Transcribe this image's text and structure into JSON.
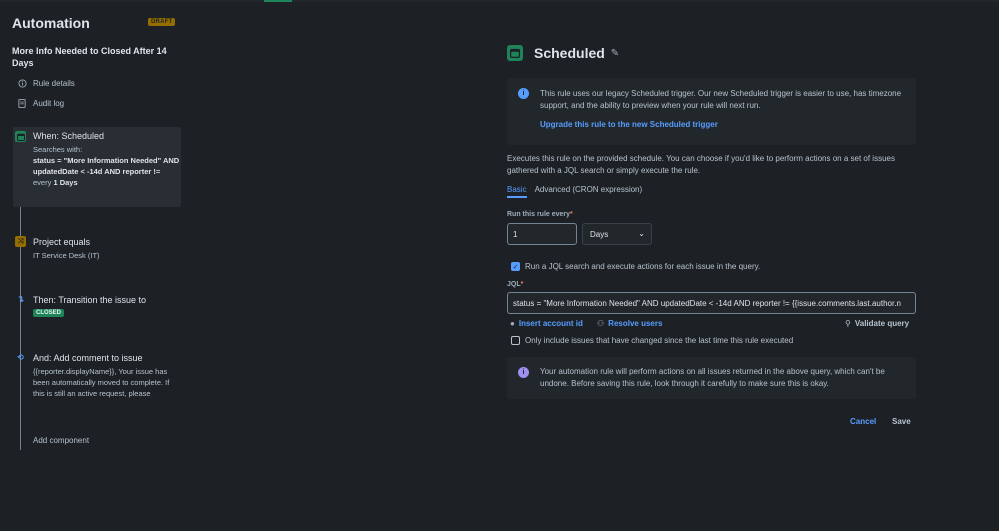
{
  "app": {
    "title": "Automation",
    "draft_badge": "DRAFT"
  },
  "rule": {
    "name": "More Info Needed to Closed After 14 Days"
  },
  "nav": {
    "rule_details": {
      "label": "Rule details",
      "icon": "info-icon"
    },
    "audit_log": {
      "label": "Audit log",
      "icon": "document-icon"
    }
  },
  "steps": [
    {
      "title": "When: Scheduled",
      "icon": "calendar-icon",
      "color": "#1f845a",
      "body_prefix": "Searches with:",
      "body_query": "status = \"More Information Needed\" AND updatedDate < -14d AND reporter !=",
      "body_every_prefix": "every",
      "body_every_value": "1 Days"
    },
    {
      "title": "Project equals",
      "icon": "branch-icon",
      "color": "#946f00",
      "body": "IT Service Desk (IT)"
    },
    {
      "title": "Then: Transition the issue to",
      "icon": "transition-icon",
      "color": "#579dff",
      "badge": "CLOSED"
    },
    {
      "title": "And: Add comment to issue",
      "icon": "comment-icon",
      "color": "#579dff",
      "body": "{{reporter.displayName}}, Your issue has been automatically moved to complete. If this is still an active request, please"
    }
  ],
  "add_component": "Add component",
  "panel": {
    "title": "Scheduled",
    "icon": "calendar-icon",
    "edit_icon": "pencil-icon",
    "info": {
      "icon": "info-icon",
      "text": "This rule uses our legacy Scheduled trigger. Our new Scheduled trigger is easier to use, has timezone support, and the ability to preview when your rule will next run.",
      "link": "Upgrade this rule to the new Scheduled trigger"
    },
    "description": "Executes this rule on the provided schedule. You can choose if you'd like to perform actions on a set of issues gathered with a JQL search or simply execute the rule.",
    "tabs": [
      {
        "label": "Basic",
        "active": true
      },
      {
        "label": "Advanced (CRON expression)",
        "active": false
      }
    ],
    "run_every": {
      "label": "Run this rule every",
      "required_mark": "*",
      "value": "1",
      "unit": "Days"
    },
    "jql_checkbox": {
      "label": "Run a JQL search and execute actions for each issue in the query.",
      "checked": true
    },
    "jql": {
      "label": "JQL",
      "required_mark": "*",
      "value": "status = \"More Information Needed\" AND updatedDate < -14d AND reporter != {{issue.comments.last.author.n"
    },
    "insert_account_id": "Insert account id",
    "resolve_users": "Resolve users",
    "validate_query": "Validate query",
    "only_changed": {
      "label": "Only include issues that have changed since the last time this rule executed",
      "checked": false
    },
    "warning": {
      "icon": "info-icon",
      "text": "Your automation rule will perform actions on all issues returned in the above query, which can't be undone. Before saving this rule, look through it carefully to make sure this is okay."
    },
    "cancel": "Cancel",
    "save": "Save"
  }
}
